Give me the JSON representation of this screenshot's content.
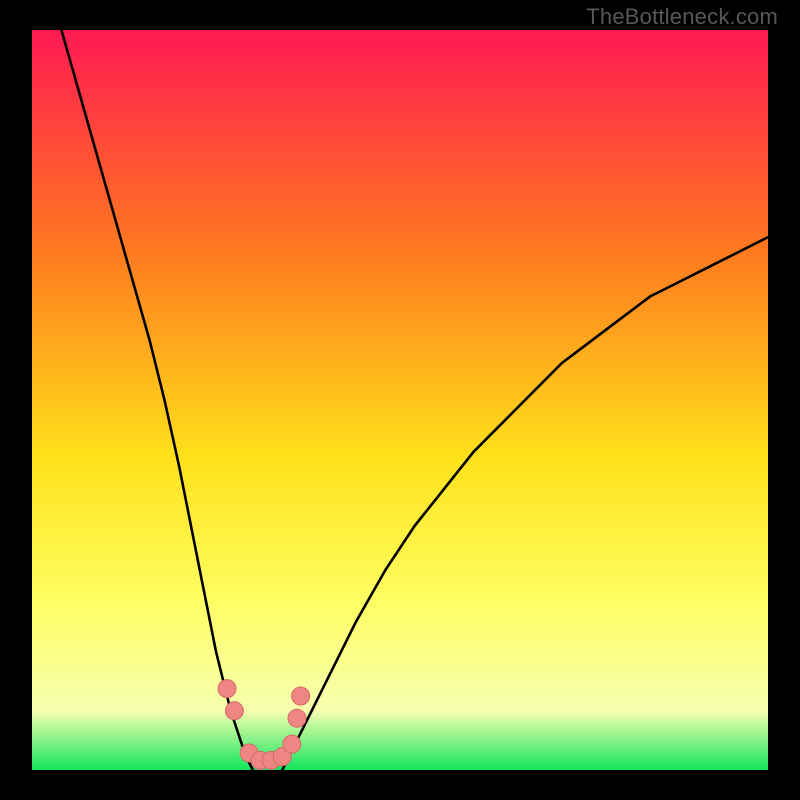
{
  "watermark": "TheBottleneck.com",
  "colors": {
    "frame": "#000000",
    "gradient_top": "#ff1a52",
    "gradient_mid1": "#ff7a1f",
    "gradient_mid2": "#ffe21a",
    "gradient_mid3": "#ffff66",
    "gradient_mid4": "#f6ffb0",
    "gradient_bottom": "#11e55d",
    "curve": "#000000",
    "marker_fill": "#ee8683",
    "marker_stroke": "#d86a66"
  },
  "chart_data": {
    "type": "line",
    "title": "",
    "xlabel": "",
    "ylabel": "",
    "xlim": [
      0,
      100
    ],
    "ylim": [
      0,
      100
    ],
    "series": [
      {
        "name": "left-branch",
        "x": [
          4,
          6,
          8,
          10,
          12,
          14,
          16,
          18,
          20,
          22,
          23,
          24,
          25,
          26,
          27,
          28,
          29,
          30
        ],
        "y": [
          100,
          93,
          86,
          79,
          72,
          65,
          58,
          50,
          41,
          31,
          26,
          21,
          16,
          12,
          8,
          5,
          2,
          0
        ]
      },
      {
        "name": "right-branch",
        "x": [
          34,
          35,
          36,
          37,
          38,
          40,
          44,
          48,
          52,
          56,
          60,
          64,
          68,
          72,
          76,
          80,
          84,
          88,
          92,
          96,
          100
        ],
        "y": [
          0,
          2,
          4,
          6,
          8,
          12,
          20,
          27,
          33,
          38,
          43,
          47,
          51,
          55,
          58,
          61,
          64,
          66,
          68,
          70,
          72
        ]
      }
    ],
    "markers": [
      {
        "x": 26.5,
        "y": 11
      },
      {
        "x": 27.5,
        "y": 8
      },
      {
        "x": 29.5,
        "y": 2.3
      },
      {
        "x": 31.0,
        "y": 1.3
      },
      {
        "x": 32.5,
        "y": 1.3
      },
      {
        "x": 34.0,
        "y": 1.8
      },
      {
        "x": 35.3,
        "y": 3.5
      },
      {
        "x": 36.0,
        "y": 7.0
      },
      {
        "x": 36.5,
        "y": 10.0
      }
    ],
    "marker_radius_px": 9
  }
}
